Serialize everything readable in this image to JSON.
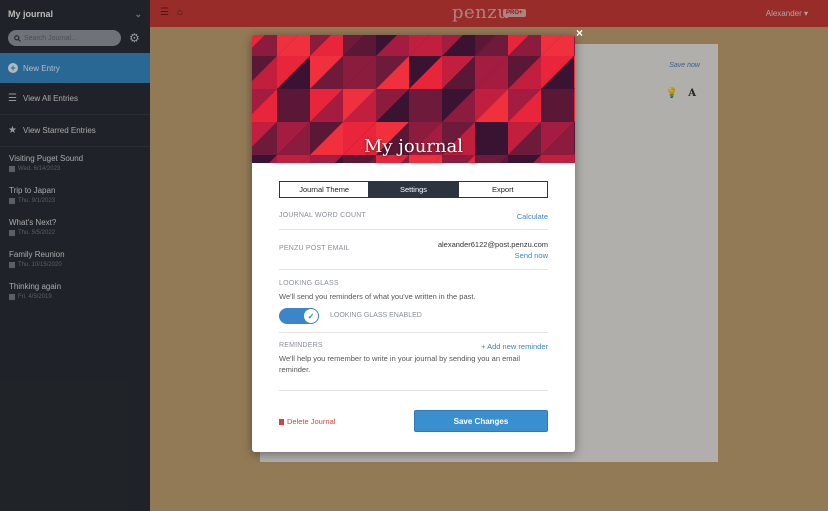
{
  "sidebar": {
    "journal_name": "My journal",
    "search_placeholder": "Search Journal...",
    "new_entry": "New Entry",
    "view_all": "View All Entries",
    "view_starred": "View Starred Entries",
    "entries": [
      {
        "title": "Visiting Puget Sound",
        "date": "Wed. 6/14/2023"
      },
      {
        "title": "Trip to Japan",
        "date": "Thu. 9/1/2023"
      },
      {
        "title": "What's Next?",
        "date": "Thu. 5/5/2022"
      },
      {
        "title": "Family Reunion",
        "date": "Thu. 10/15/2020"
      },
      {
        "title": "Thinking again",
        "date": "Fri. 4/5/2019"
      }
    ]
  },
  "topbar": {
    "logo": "penzu",
    "badge": "PRO+",
    "user": "Alexander ▾"
  },
  "paper": {
    "save_now": "Save now",
    "font_tool": "A"
  },
  "modal": {
    "title": "My journal",
    "tabs": [
      "Journal Theme",
      "Settings",
      "Export"
    ],
    "word_count": {
      "label": "JOURNAL WORD COUNT",
      "action": "Calculate"
    },
    "post_email": {
      "label": "PENZU POST EMAIL",
      "email": "alexander6122@post.penzu.com",
      "action": "Send now"
    },
    "looking_glass": {
      "label": "LOOKING GLASS",
      "description": "We'll send you reminders of what you've written in the past.",
      "toggle_label": "LOOKING GLASS ENABLED",
      "enabled": true
    },
    "reminders": {
      "label": "REMINDERS",
      "action": "+ Add new reminder",
      "description": "We'll help you remember to write in your journal by sending you an email reminder."
    },
    "delete": "Delete Journal",
    "save": "Save Changes",
    "close": "×"
  }
}
